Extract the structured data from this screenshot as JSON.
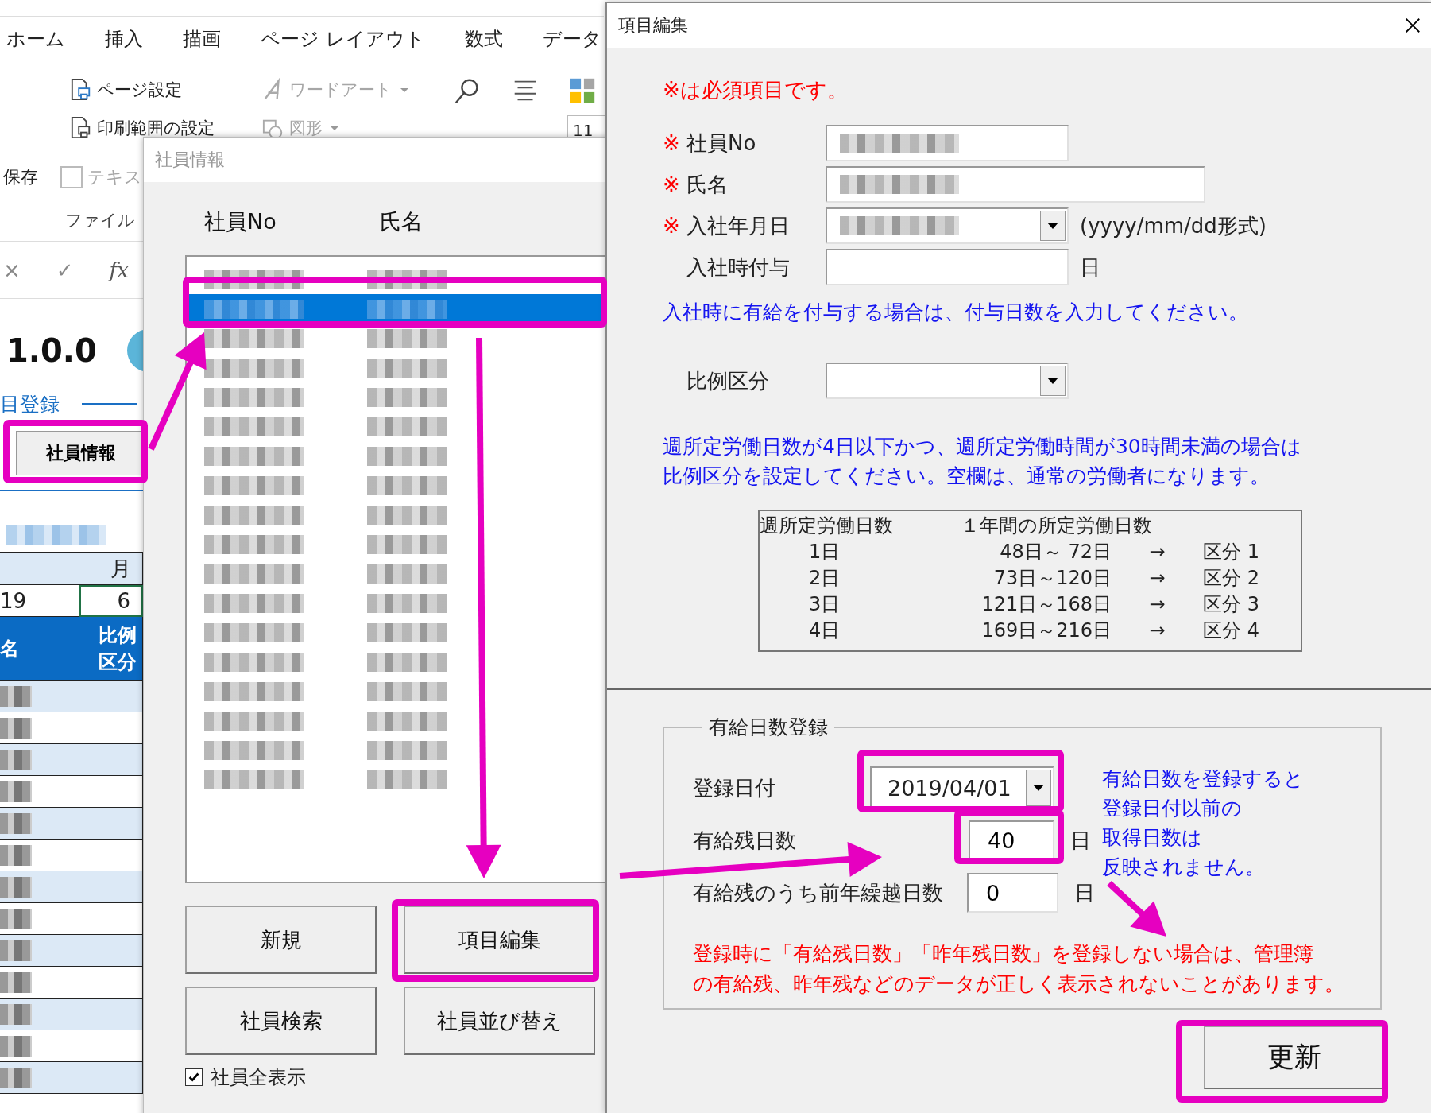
{
  "excel": {
    "ribbon_tabs": [
      "ホーム",
      "挿入",
      "描画",
      "ページ レイアウト",
      "数式",
      "データ"
    ],
    "ribbon_commands": [
      {
        "label": "ページ設定",
        "kind": "page-setup",
        "disabled": false
      },
      {
        "label": "ワードアート",
        "kind": "wordart",
        "disabled": true
      },
      {
        "label": "印刷範囲の設定",
        "kind": "print-area",
        "disabled": false
      },
      {
        "label": "図形",
        "kind": "shapes",
        "disabled": true
      }
    ],
    "save_label": "保存",
    "text_command": "テキス",
    "group_label": "ファイル",
    "zoom_value": "11",
    "formula_bar": {
      "cancel": "×",
      "enter": "✓",
      "function": "fx"
    },
    "version": "1.0.0",
    "nav_link": "目登録",
    "nav_button": "社員情報",
    "sheet": {
      "month_header": "月",
      "year": "19",
      "month": "6",
      "name_header": "名",
      "ratio_header": "比例区分",
      "rows": [
        {
          "shaded": true
        },
        {
          "shaded": false
        },
        {
          "shaded": true
        },
        {
          "shaded": false
        },
        {
          "shaded": true
        },
        {
          "shaded": false
        },
        {
          "shaded": true
        },
        {
          "shaded": false
        },
        {
          "shaded": true
        },
        {
          "shaded": false
        },
        {
          "shaded": true
        },
        {
          "shaded": false
        },
        {
          "shaded": true
        }
      ]
    }
  },
  "employee_dialog": {
    "title": "社員情報",
    "columns": [
      "社員No",
      "氏名"
    ],
    "rows": [
      {
        "selected": false
      },
      {
        "selected": true
      },
      {
        "selected": false
      },
      {
        "selected": false
      },
      {
        "selected": false
      },
      {
        "selected": false
      },
      {
        "selected": false
      },
      {
        "selected": false
      },
      {
        "selected": false
      },
      {
        "selected": false
      },
      {
        "selected": false
      },
      {
        "selected": false
      },
      {
        "selected": false
      },
      {
        "selected": false
      },
      {
        "selected": false
      },
      {
        "selected": false
      },
      {
        "selected": false
      },
      {
        "selected": false
      }
    ],
    "buttons": [
      "新規",
      "項目編集",
      "社員検索",
      "社員並び替え"
    ],
    "show_all": {
      "label": "社員全表示",
      "checked": true
    }
  },
  "edit_dialog": {
    "title": "項目編集",
    "required_note": "※は必須項目です。",
    "fields": [
      {
        "mark": "※",
        "label": "社員No",
        "kind": "short_text",
        "redacted": true
      },
      {
        "mark": "※",
        "label": "氏名",
        "kind": "long_text",
        "redacted": true
      },
      {
        "mark": "※",
        "label": "入社年月日",
        "kind": "combo",
        "redacted": true,
        "suffix": "(yyyy/mm/dd形式)"
      },
      {
        "label": "入社時付与",
        "kind": "short_text",
        "redacted": false,
        "suffix": "日"
      }
    ],
    "grant_note": "入社時に有給を付与する場合は、付与日数を入力してください。",
    "ratio_label": "比例区分",
    "ratio_note": [
      "週所定労働日数が4日以下かつ、週所定労働時間が30時間未満の場合は",
      "比例区分を設定してください。空欄は、通常の労働者になります。"
    ],
    "ratio_table": {
      "header": [
        "週所定労働日数",
        "１年間の所定労働日数"
      ],
      "rows": [
        {
          "days": "1日",
          "range": "48日～ 72日",
          "arrow": "→",
          "class": "区分 1"
        },
        {
          "days": "2日",
          "range": "73日～120日",
          "arrow": "→",
          "class": "区分 2"
        },
        {
          "days": "3日",
          "range": "121日～168日",
          "arrow": "→",
          "class": "区分 3"
        },
        {
          "days": "4日",
          "range": "169日～216日",
          "arrow": "→",
          "class": "区分 4"
        }
      ]
    },
    "leave": {
      "legend": "有給日数登録",
      "date": {
        "label": "登録日付",
        "value": "2019/04/01"
      },
      "remaining": {
        "label": "有給残日数",
        "value": "40",
        "unit": "日"
      },
      "carryover": {
        "label": "有給残のうち前年繰越日数",
        "value": "0",
        "unit": "日"
      },
      "side_note": [
        "有給日数を登録すると",
        "登録日付以前の",
        "取得日数は",
        "反映されません。"
      ],
      "warning": [
        "登録時に「有給残日数」「昨年残日数」を登録しない場合は、管理簿",
        "の有給残、昨年残などのデータが正しく表示されないことがあります。"
      ]
    },
    "submit": "更新"
  }
}
